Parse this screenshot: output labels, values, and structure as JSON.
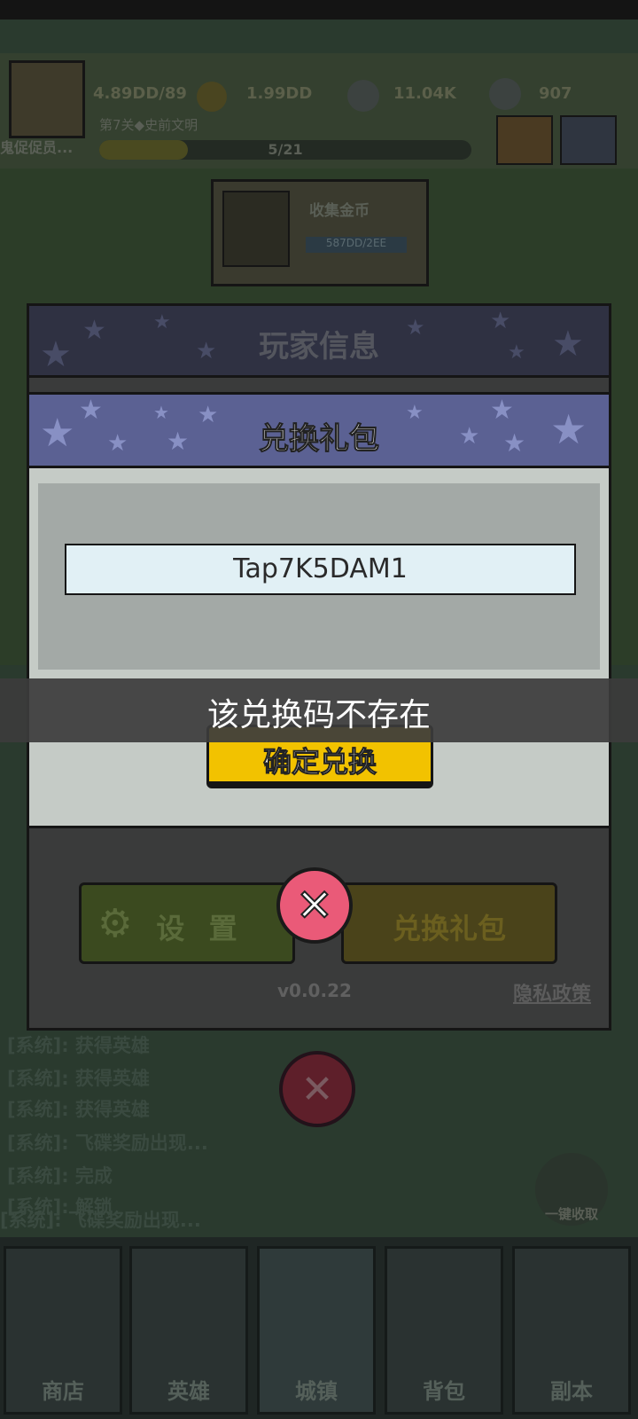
{
  "background": {
    "top_bar": {
      "player_name": "鬼促促员...",
      "exp": "4.89DD/89",
      "gold": "1.99DD",
      "gems": "11.04K",
      "energy": "907",
      "stage": "第7关◆史前文明",
      "progress": "5/21"
    },
    "mission": {
      "title": "收集金币",
      "progress": "587DD/2EE"
    },
    "log": [
      "[系统]: 获得英雄",
      "[系统]: 获得英雄",
      "[系统]: 获得英雄",
      "[系统]: 飞碟奖励出现...",
      "[系统]: 完成",
      "[系统]: 解锁",
      "[系统]: 飞碟奖励出现..."
    ],
    "collect_all": "一键收取",
    "nav": [
      "商店",
      "英雄",
      "城镇",
      "背包",
      "副本"
    ]
  },
  "player_panel": {
    "title": "玩家信息",
    "settings_label": "设 置",
    "gift_label": "兑换礼包",
    "version": "v0.0.22",
    "privacy": "隐私政策"
  },
  "redeem": {
    "title": "兑换礼包",
    "code_value": "Tap7K5DAM1",
    "confirm_label": "确定兑换"
  },
  "toast": {
    "message": "该兑换码不存在"
  },
  "colors": {
    "header": "#5b6193",
    "confirm": "#f2c200",
    "close": "#ea5a78"
  }
}
